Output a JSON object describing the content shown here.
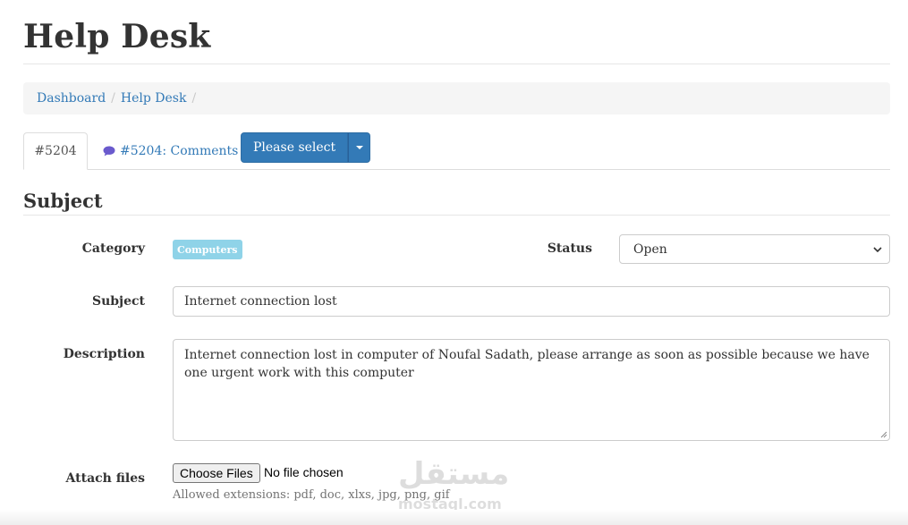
{
  "page": {
    "title": "Help Desk"
  },
  "breadcrumb": {
    "items": [
      "Dashboard",
      "Help Desk"
    ],
    "separator": "/"
  },
  "tabs": {
    "active": "#5204",
    "comments": "#5204: Comments"
  },
  "actions": {
    "select_label": "Please select"
  },
  "section": {
    "title": "Subject"
  },
  "form": {
    "category_label": "Category",
    "category_value": "Computers",
    "status_label": "Status",
    "status_value": "Open",
    "subject_label": "Subject",
    "subject_value": "Internet connection lost",
    "description_label": "Description",
    "description_value": "Internet connection lost in computer of Noufal Sadath, please arrange as soon as possible because we have one urgent work with this computer",
    "attach_label": "Attach files",
    "file_button": "Choose Files",
    "file_status": "No file chosen",
    "allowed_text": "Allowed extensions: pdf, doc, xlxs, jpg, png, gif"
  },
  "watermark": {
    "arabic": "مستقل",
    "latin": "mostaql.com"
  },
  "colors": {
    "primary": "#337ab7",
    "badge": "#8fd3e8",
    "breadcrumb_bg": "#f5f5f5"
  }
}
